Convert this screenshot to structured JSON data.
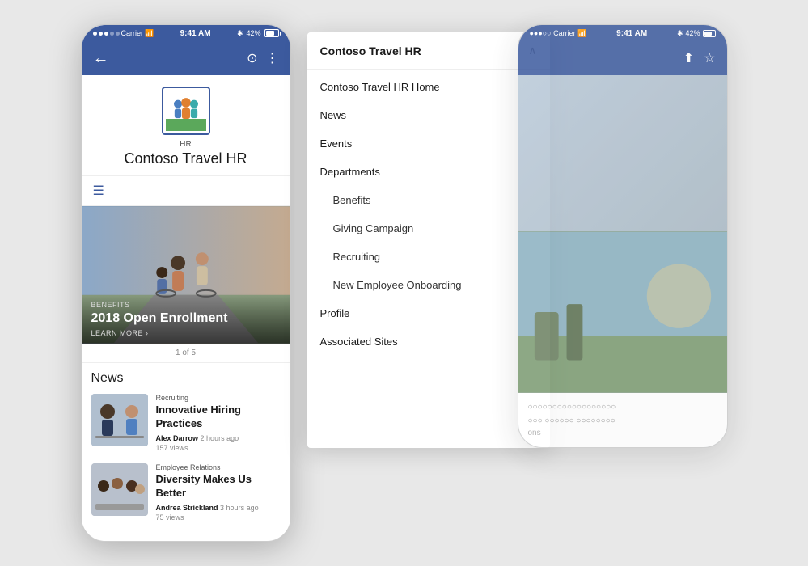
{
  "phone": {
    "status_bar": {
      "dots": [
        "filled",
        "filled",
        "filled",
        "empty",
        "empty"
      ],
      "carrier": "Carrier",
      "wifi": "WiFi",
      "time": "9:41 AM",
      "bluetooth": "42%"
    },
    "nav": {
      "back_label": "←",
      "search_label": "⊙",
      "more_label": "⋮"
    },
    "header": {
      "site_label": "HR",
      "site_title": "Contoso Travel HR"
    },
    "hero": {
      "tag": "Benefits",
      "headline": "2018 Open Enrollment",
      "learn_more": "LEARN MORE ›"
    },
    "pagination": "1 of 5",
    "news_heading": "News",
    "news_items": [
      {
        "category": "Recruiting",
        "title": "Innovative Hiring Practices",
        "author": "Alex Darrow",
        "time": "2 hours ago",
        "views": "157 views"
      },
      {
        "category": "Employee Relations",
        "title": "Diversity Makes Us Better",
        "author": "Andrea Strickland",
        "time": "3 hours ago",
        "views": "75 views"
      }
    ]
  },
  "dropdown": {
    "title": "Contoso Travel HR",
    "chevron": "∧",
    "items": [
      {
        "label": "Contoso Travel HR Home",
        "type": "main"
      },
      {
        "label": "News",
        "type": "main"
      },
      {
        "label": "Events",
        "type": "main"
      },
      {
        "label": "Departments",
        "type": "main"
      },
      {
        "label": "Benefits",
        "type": "sub"
      },
      {
        "label": "Giving Campaign",
        "type": "sub"
      },
      {
        "label": "Recruiting",
        "type": "sub"
      },
      {
        "label": "New Employee Onboarding",
        "type": "sub"
      },
      {
        "label": "Profile",
        "type": "main"
      },
      {
        "label": "Associated Sites",
        "type": "main"
      }
    ]
  },
  "phone_ghost": {
    "status_bar_time": "9:41 AM",
    "battery": "42%"
  }
}
